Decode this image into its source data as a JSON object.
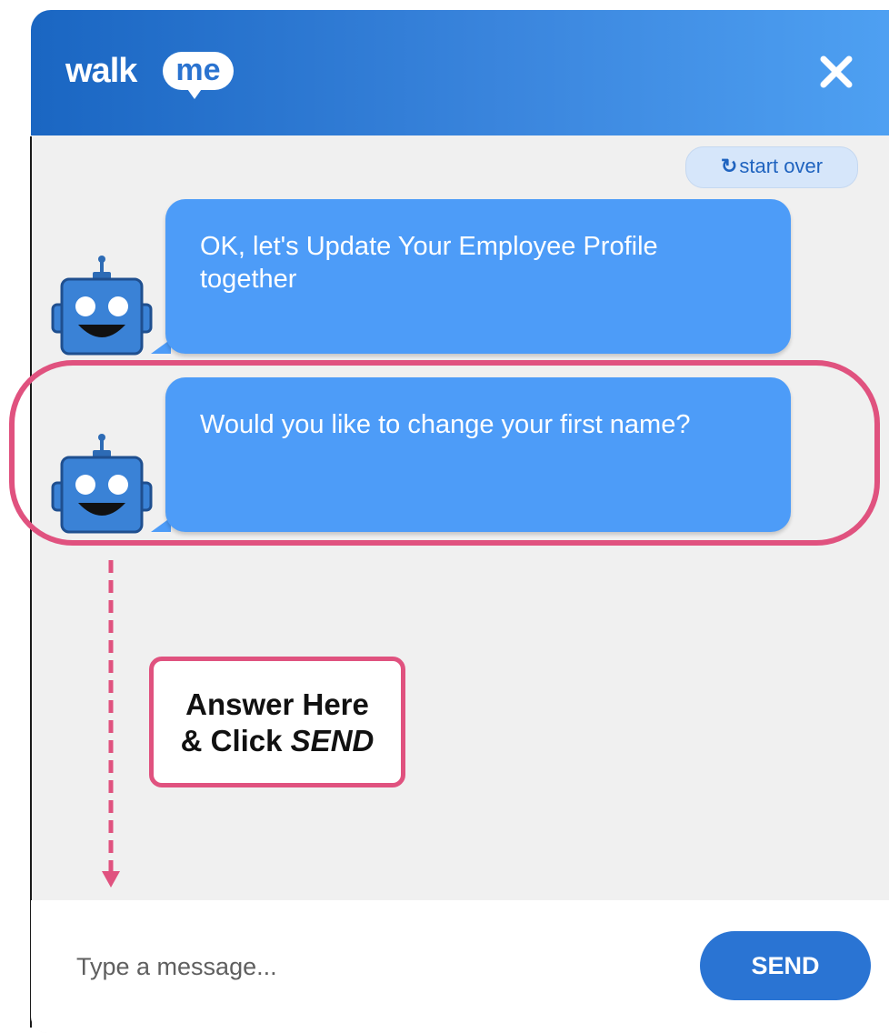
{
  "header": {
    "logo_walk": "walk",
    "logo_me": "me",
    "colors": {
      "gradient_start": "#1a66c2",
      "gradient_end": "#4ea0f2"
    }
  },
  "toolbar": {
    "restart_icon": "↻",
    "restart_label": "start over"
  },
  "messages": [
    {
      "sender": "bot",
      "text": "OK, let's Update Your Employee Profile together"
    },
    {
      "sender": "bot",
      "text": "Would you like to change your first name?"
    }
  ],
  "annotation": {
    "line1": "Answer Here",
    "line2_prefix": "& Click ",
    "line2_emphasis": "SEND",
    "color": "#e0527f"
  },
  "composer": {
    "placeholder": "Type a message...",
    "send_label": "SEND"
  },
  "icons": {
    "close": "close-icon",
    "robot": "robot-avatar-icon",
    "restart": "refresh-icon"
  },
  "colors": {
    "bubble": "#4d9cf8",
    "send_button": "#2a74d3",
    "background": "#f0f0f0"
  }
}
